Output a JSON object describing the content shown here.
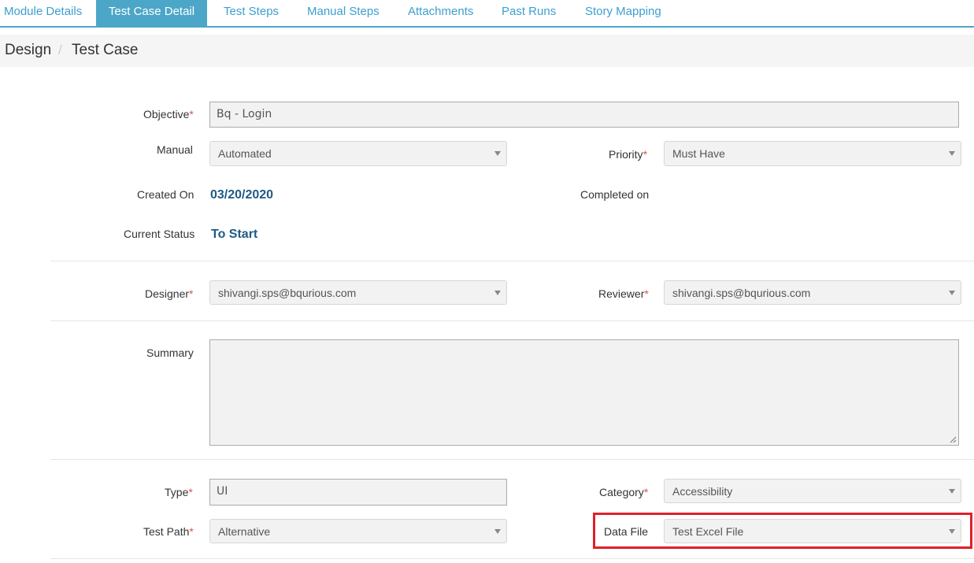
{
  "tabs": [
    {
      "label": "Module Details"
    },
    {
      "label": "Test Case Detail"
    },
    {
      "label": "Test Steps"
    },
    {
      "label": "Manual Steps"
    },
    {
      "label": "Attachments"
    },
    {
      "label": "Past Runs"
    },
    {
      "label": "Story Mapping"
    }
  ],
  "active_tab": "Test Case Detail",
  "breadcrumb": {
    "items": [
      "Design",
      "Test Case"
    ],
    "separator": "/"
  },
  "form": {
    "objective": {
      "label": "Objective",
      "required": "*",
      "value": "Bq - Login"
    },
    "manual": {
      "label": "Manual",
      "value": "Automated"
    },
    "priority": {
      "label": "Priority",
      "required": "*",
      "value": "Must Have"
    },
    "created_on": {
      "label": "Created On",
      "value": "03/20/2020"
    },
    "completed_on": {
      "label": "Completed on",
      "value": ""
    },
    "current_status": {
      "label": "Current Status",
      "value": "To Start"
    },
    "designer": {
      "label": "Designer",
      "required": "*",
      "value": "shivangi.sps@bqurious.com"
    },
    "reviewer": {
      "label": "Reviewer",
      "required": "*",
      "value": "shivangi.sps@bqurious.com"
    },
    "summary": {
      "label": "Summary",
      "value": ""
    },
    "type": {
      "label": "Type",
      "required": "*",
      "value": "UI"
    },
    "category": {
      "label": "Category",
      "required": "*",
      "value": "Accessibility"
    },
    "test_path": {
      "label": "Test Path",
      "required": "*",
      "value": "Alternative"
    },
    "data_file": {
      "label": "Data File",
      "value": "Test Excel File"
    }
  },
  "colors": {
    "accent": "#4ca6c8",
    "link": "#3c9fd0",
    "required": "#d9534f",
    "highlight": "#e0202a",
    "value": "#1f5a85"
  },
  "icons": {
    "select_caret": "caret-down-icon",
    "resize_grip": "resize-grip-icon"
  }
}
